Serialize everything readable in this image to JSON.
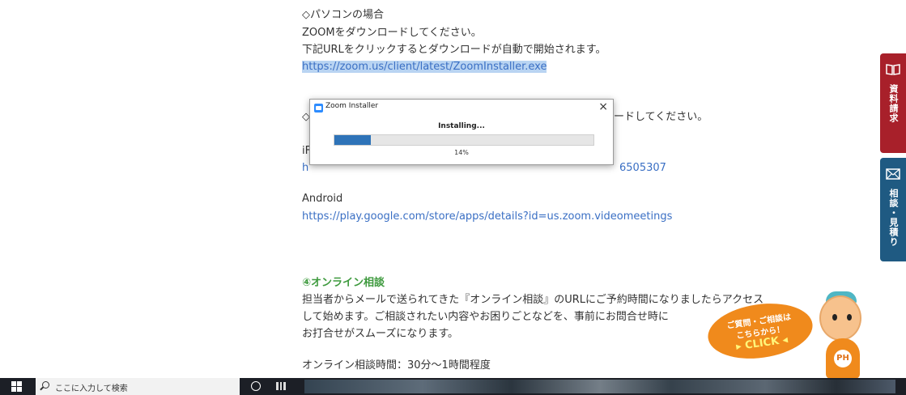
{
  "content": {
    "pc_heading": "◇パソコンの場合",
    "pc_line1": "ZOOMをダウンロードしてください。",
    "pc_line2": "下記URLをクリックするとダウンロードが自動で開始されます。",
    "pc_url": "https://zoom.us/client/latest/ZoomInstaller.exe",
    "mobile_heading_start": "◇",
    "mobile_heading_end": "ードしてください。",
    "iphone_label_partial": "iF",
    "iphone_url_start": "h",
    "iphone_url_end": "6505307",
    "android_label": "Android",
    "android_url": "https://play.google.com/store/apps/details?id=us.zoom.videomeetings",
    "section4_heading": "④オンライン相談",
    "section4_line1": "担当者からメールで送られてきた『オンライン相談』のURLにご予約時間になりましたらアクセス",
    "section4_line2": "して始めます。ご相談されたい内容やお困りごとなどを、事前にお問合せ時に",
    "section4_line3": "お打合せがスムーズになります。",
    "duration": "オンライン相談時間：30分〜1時間程度"
  },
  "dialog": {
    "title": "Zoom Installer",
    "close": "×",
    "status": "Installing...",
    "progress_percent": 14,
    "percent_label": "14%"
  },
  "side_tabs": {
    "request": "資料請求",
    "consult": "相談・見積り"
  },
  "mascot": {
    "bubble_line1": "ご質問・ご相談は",
    "bubble_line2": "こちらから！",
    "bubble_click": "▸ CLICK ◂",
    "badge": "PH"
  },
  "taskbar": {
    "search_placeholder": "ここに入力して検索"
  },
  "colors": {
    "link": "#3a6fc4",
    "heading_green": "#3e9a3e",
    "tab_red": "#a8202a",
    "tab_blue": "#1f5a82",
    "progress": "#2e73b8"
  }
}
